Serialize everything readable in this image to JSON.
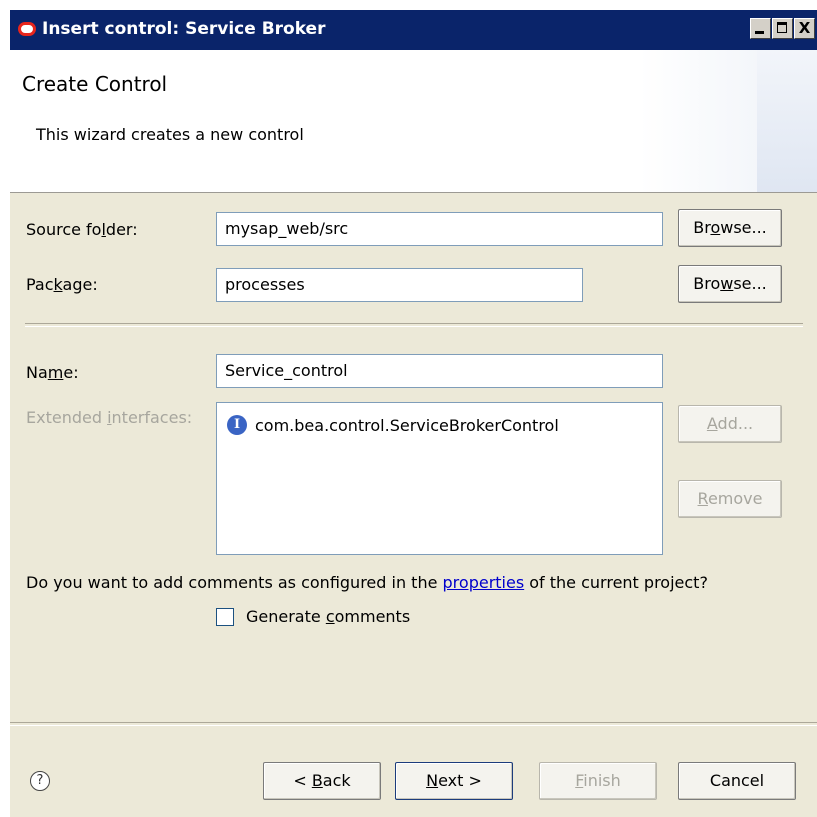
{
  "window": {
    "title": "Insert control: Service Broker",
    "controls": {
      "minimize": "_",
      "maximize": "□",
      "close": "X"
    }
  },
  "header": {
    "title": "Create Control",
    "description": "This wizard creates a new control"
  },
  "form": {
    "source_folder": {
      "label_pre": "Source fo",
      "label_u": "l",
      "label_post": "der:",
      "value": "mysap_web/src",
      "browse": {
        "pre": "Br",
        "u": "o",
        "post": "wse..."
      }
    },
    "package": {
      "label_pre": "Pac",
      "label_u": "k",
      "label_post": "age:",
      "value": "processes",
      "browse": {
        "pre": "Bro",
        "u": "w",
        "post": "se..."
      }
    },
    "name": {
      "label_pre": "Na",
      "label_u": "m",
      "label_post": "e:",
      "value": "Service_control"
    },
    "extended_interfaces": {
      "label_pre": "Extended ",
      "label_u": "i",
      "label_post": "nterfaces:",
      "items": [
        "com.bea.control.ServiceBrokerControl"
      ],
      "item_icon": "interface-icon",
      "add": {
        "u": "A",
        "post": "dd..."
      },
      "remove": {
        "u": "R",
        "post": "emove"
      }
    },
    "comments": {
      "question_pre": "Do you want to add comments as configured in the ",
      "question_link": "properties",
      "question_post": " of the current project?",
      "checkbox_pre": "Generate ",
      "checkbox_u": "c",
      "checkbox_post": "omments",
      "checked": false
    }
  },
  "footer": {
    "help_icon": "?",
    "back": {
      "pre": "< ",
      "u": "B",
      "post": "ack"
    },
    "next": {
      "u": "N",
      "post": "ext >"
    },
    "finish": {
      "u": "F",
      "post": "inish"
    },
    "cancel": "Cancel"
  }
}
